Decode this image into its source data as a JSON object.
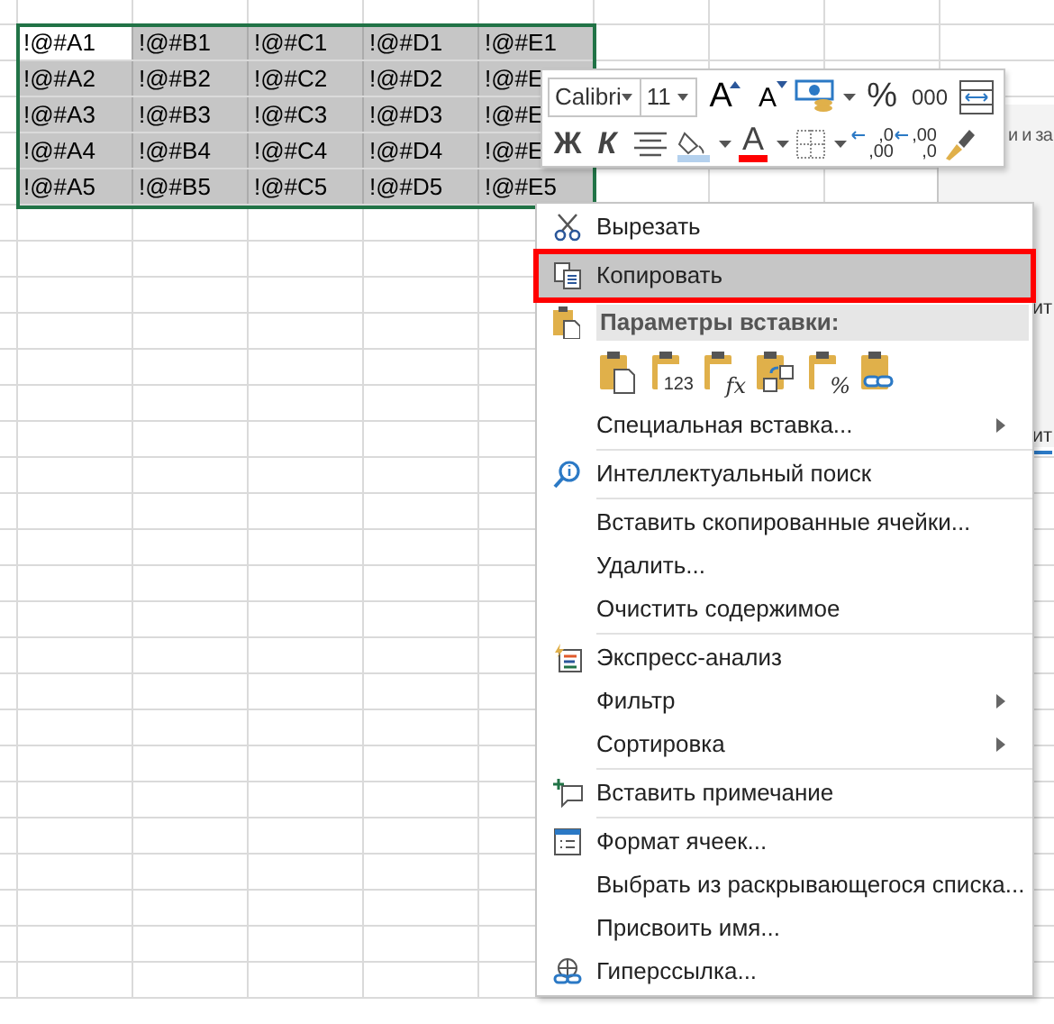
{
  "sheet": {
    "rows": [
      [
        {
          "text": "!@#A1",
          "selected": false
        },
        {
          "text": "!@#B1",
          "selected": true
        },
        {
          "text": "!@#C1",
          "selected": true
        },
        {
          "text": "!@#D1",
          "selected": true
        },
        {
          "text": "!@#E1",
          "selected": true
        }
      ],
      [
        {
          "text": "!@#A2",
          "selected": true
        },
        {
          "text": "!@#B2",
          "selected": true
        },
        {
          "text": "!@#C2",
          "selected": true
        },
        {
          "text": "!@#D2",
          "selected": true
        },
        {
          "text": "!@#E",
          "selected": true
        }
      ],
      [
        {
          "text": "!@#A3",
          "selected": true
        },
        {
          "text": "!@#B3",
          "selected": true
        },
        {
          "text": "!@#C3",
          "selected": true
        },
        {
          "text": "!@#D3",
          "selected": true
        },
        {
          "text": "!@#E",
          "selected": true
        }
      ],
      [
        {
          "text": "!@#A4",
          "selected": true
        },
        {
          "text": "!@#B4",
          "selected": true
        },
        {
          "text": "!@#C4",
          "selected": true
        },
        {
          "text": "!@#D4",
          "selected": true
        },
        {
          "text": "!@#E",
          "selected": true
        }
      ],
      [
        {
          "text": "!@#A5",
          "selected": true
        },
        {
          "text": "!@#B5",
          "selected": true
        },
        {
          "text": "!@#C5",
          "selected": true
        },
        {
          "text": "!@#D5",
          "selected": true
        },
        {
          "text": "!@#E5",
          "selected": true
        }
      ]
    ]
  },
  "background_dialog": {
    "texts": [
      "и и за",
      "ит",
      "ит"
    ]
  },
  "mini_toolbar": {
    "font": "Calibri",
    "size": "11",
    "row_1": [
      {
        "kind": "grow",
        "label": "A"
      },
      {
        "kind": "shrink",
        "label": "A"
      },
      {
        "kind": "accounting"
      },
      {
        "kind": "text",
        "label": "%"
      },
      {
        "kind": "text",
        "label": "000"
      },
      {
        "kind": "wrap"
      }
    ],
    "row_2": [
      {
        "kind": "bold",
        "label": "Ж"
      },
      {
        "kind": "italic",
        "label": "К"
      },
      {
        "kind": "align"
      },
      {
        "kind": "fill"
      },
      {
        "kind": "fontcolor",
        "label": "A"
      },
      {
        "kind": "borders"
      },
      {
        "kind": "decimal",
        "top": ",0",
        "bottom": ",00"
      },
      {
        "kind": "decimal",
        "top": ",00",
        "bottom": ",0"
      },
      {
        "kind": "painter"
      }
    ]
  },
  "context_menu": {
    "items": [
      {
        "kind": "item",
        "label": "Вырезать",
        "selected": false,
        "submenu": false
      },
      {
        "kind": "item",
        "label": "Копировать",
        "selected": true,
        "submenu": false
      },
      {
        "kind": "header",
        "label": "Параметры вставки:"
      },
      {
        "kind": "paste_options",
        "options": [
          {
            "kind": "paste"
          },
          {
            "kind": "badge",
            "label": "123"
          },
          {
            "kind": "badge",
            "label": "fx"
          },
          {
            "kind": "transpose"
          },
          {
            "kind": "badge",
            "label": "%"
          },
          {
            "kind": "link"
          }
        ]
      },
      {
        "kind": "item",
        "label": "Специальная вставка...",
        "selected": false,
        "submenu": true
      },
      {
        "kind": "separator"
      },
      {
        "kind": "item",
        "label": "Интеллектуальный поиск",
        "selected": false,
        "submenu": false
      },
      {
        "kind": "separator"
      },
      {
        "kind": "item",
        "label": "Вставить скопированные ячейки...",
        "selected": false,
        "submenu": false
      },
      {
        "kind": "item",
        "label": "Удалить...",
        "selected": false,
        "submenu": false
      },
      {
        "kind": "item",
        "label": "Очистить содержимое",
        "selected": false,
        "submenu": false
      },
      {
        "kind": "separator"
      },
      {
        "kind": "item",
        "label": "Экспресс-анализ",
        "selected": false,
        "submenu": false
      },
      {
        "kind": "item",
        "label": "Фильтр",
        "selected": false,
        "submenu": true
      },
      {
        "kind": "item",
        "label": "Сортировка",
        "selected": false,
        "submenu": true
      },
      {
        "kind": "separator"
      },
      {
        "kind": "item",
        "label": "Вставить примечание",
        "selected": false,
        "submenu": false
      },
      {
        "kind": "separator"
      },
      {
        "kind": "item",
        "label": "Формат ячеек...",
        "selected": false,
        "submenu": false
      },
      {
        "kind": "item",
        "label": "Выбрать из раскрывающегося списка...",
        "selected": false,
        "submenu": false
      },
      {
        "kind": "item",
        "label": "Присвоить имя...",
        "selected": false,
        "submenu": false
      },
      {
        "kind": "item",
        "label": "Гиперссылка...",
        "selected": false,
        "submenu": false
      }
    ]
  }
}
